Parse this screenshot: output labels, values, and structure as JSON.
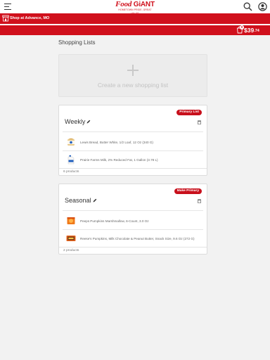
{
  "header": {
    "logo_main": "Food",
    "logo_giant": "GiANT",
    "logo_tagline": "HOMETOWN PRIDE, GREAT VALUE",
    "menu_icon": "hamburger-menu-icon",
    "search_icon": "search-icon",
    "account_icon": "user-icon"
  },
  "store": {
    "label": "Shop at Advance, MO",
    "icon": "store-icon"
  },
  "cart": {
    "icon": "cart-icon",
    "badge": "0",
    "total_dollars": "$39",
    "total_cents": ".74"
  },
  "page": {
    "title": "Shopping Lists",
    "create_label": "Create a new shopping list"
  },
  "lists": [
    {
      "name": "Weekly",
      "badge": "Primary List",
      "items": [
        "Lewis Bread, Butter White, 1/2 Loaf, 12 Oz (340 G)",
        "Prairie Farms Milk, 2% Reduced Fat, 1 Gallon (3.78 L)"
      ],
      "count": "6 products"
    },
    {
      "name": "Seasonal",
      "badge": "Make Primary",
      "items": [
        "Peeps Pumpkins Marshmallow, 6-Count, 3.0 Oz",
        "Reese's Pumpkins, Milk Chocolate & Peanut Butter, Snack Size, 9.6 Oz (272 G)"
      ],
      "count": "2 products"
    }
  ],
  "colors": {
    "brand_red": "#d0101c",
    "background": "#f2f2f2"
  }
}
